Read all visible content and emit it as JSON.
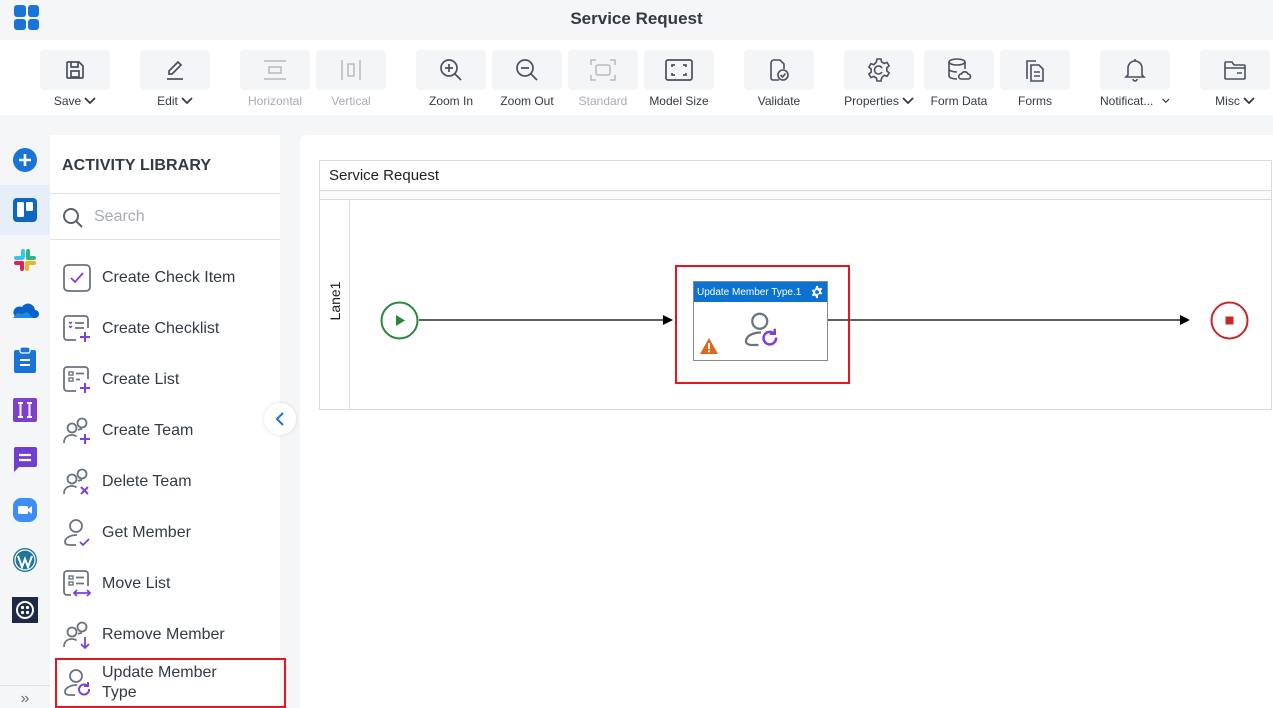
{
  "app": {
    "title": "Service Request"
  },
  "toolbar": {
    "buttons": [
      {
        "id": "save",
        "label": "Save",
        "icon": "save-icon",
        "dropdown": true,
        "disabled": false
      },
      {
        "id": "edit",
        "label": "Edit",
        "icon": "pencil-icon",
        "dropdown": true,
        "disabled": false
      },
      {
        "id": "horizontal",
        "label": "Horizontal",
        "icon": "horizontal-layout-icon",
        "dropdown": false,
        "disabled": true
      },
      {
        "id": "vertical",
        "label": "Vertical",
        "icon": "vertical-layout-icon",
        "dropdown": false,
        "disabled": true
      },
      {
        "id": "zoom-in",
        "label": "Zoom In",
        "icon": "zoom-in-icon",
        "dropdown": false,
        "disabled": false
      },
      {
        "id": "zoom-out",
        "label": "Zoom Out",
        "icon": "zoom-out-icon",
        "dropdown": false,
        "disabled": false
      },
      {
        "id": "standard",
        "label": "Standard",
        "icon": "standard-size-icon",
        "dropdown": false,
        "disabled": true
      },
      {
        "id": "model-size",
        "label": "Model Size",
        "icon": "model-size-icon",
        "dropdown": false,
        "disabled": false
      },
      {
        "id": "validate",
        "label": "Validate",
        "icon": "validate-icon",
        "dropdown": false,
        "disabled": false
      },
      {
        "id": "properties",
        "label": "Properties",
        "icon": "gear-icon",
        "dropdown": true,
        "disabled": false
      },
      {
        "id": "form-data",
        "label": "Form Data",
        "icon": "database-icon",
        "dropdown": false,
        "disabled": false
      },
      {
        "id": "forms",
        "label": "Forms",
        "icon": "forms-icon",
        "dropdown": false,
        "disabled": false
      },
      {
        "id": "notifications",
        "label": "Notificat...",
        "icon": "bell-icon",
        "dropdown": true,
        "disabled": false
      },
      {
        "id": "misc",
        "label": "Misc",
        "icon": "folder-icon",
        "dropdown": true,
        "disabled": false
      }
    ]
  },
  "rail": {
    "items": [
      {
        "name": "add-icon",
        "active": false
      },
      {
        "name": "trello-icon",
        "active": true
      },
      {
        "name": "slack-icon",
        "active": false
      },
      {
        "name": "onedrive-icon",
        "active": false
      },
      {
        "name": "clipboard-icon",
        "active": false
      },
      {
        "name": "ii-app-icon",
        "active": false
      },
      {
        "name": "chat-icon",
        "active": false
      },
      {
        "name": "zoom-video-icon",
        "active": false
      },
      {
        "name": "wordpress-icon",
        "active": false
      },
      {
        "name": "twilio-icon",
        "active": false
      }
    ],
    "expand_label": "»"
  },
  "library": {
    "title": "ACTIVITY LIBRARY",
    "search_placeholder": "Search",
    "search_value": "",
    "items": [
      {
        "label": "Create Check Item",
        "icon": "checkbox-icon"
      },
      {
        "label": "Create Checklist",
        "icon": "checklist-add-icon"
      },
      {
        "label": "Create List",
        "icon": "list-add-icon"
      },
      {
        "label": "Create Team",
        "icon": "team-add-icon"
      },
      {
        "label": "Delete Team",
        "icon": "team-delete-icon"
      },
      {
        "label": "Get Member",
        "icon": "member-get-icon"
      },
      {
        "label": "Move List",
        "icon": "list-move-icon"
      },
      {
        "label": "Remove Member",
        "icon": "member-remove-icon"
      },
      {
        "label": "Update Member Type",
        "icon": "member-update-icon",
        "highlighted": true
      }
    ]
  },
  "canvas": {
    "pool_title": "Service Request",
    "lane_label": "Lane1",
    "task": {
      "name": "Update Member Type.1",
      "warning": true
    },
    "colors": {
      "start": "#2e8540",
      "end": "#c62828",
      "task_header": "#0c72d2",
      "highlight": "#e3171d",
      "warning": "#d9691c",
      "accent_purple": "#7b3fe4"
    }
  }
}
